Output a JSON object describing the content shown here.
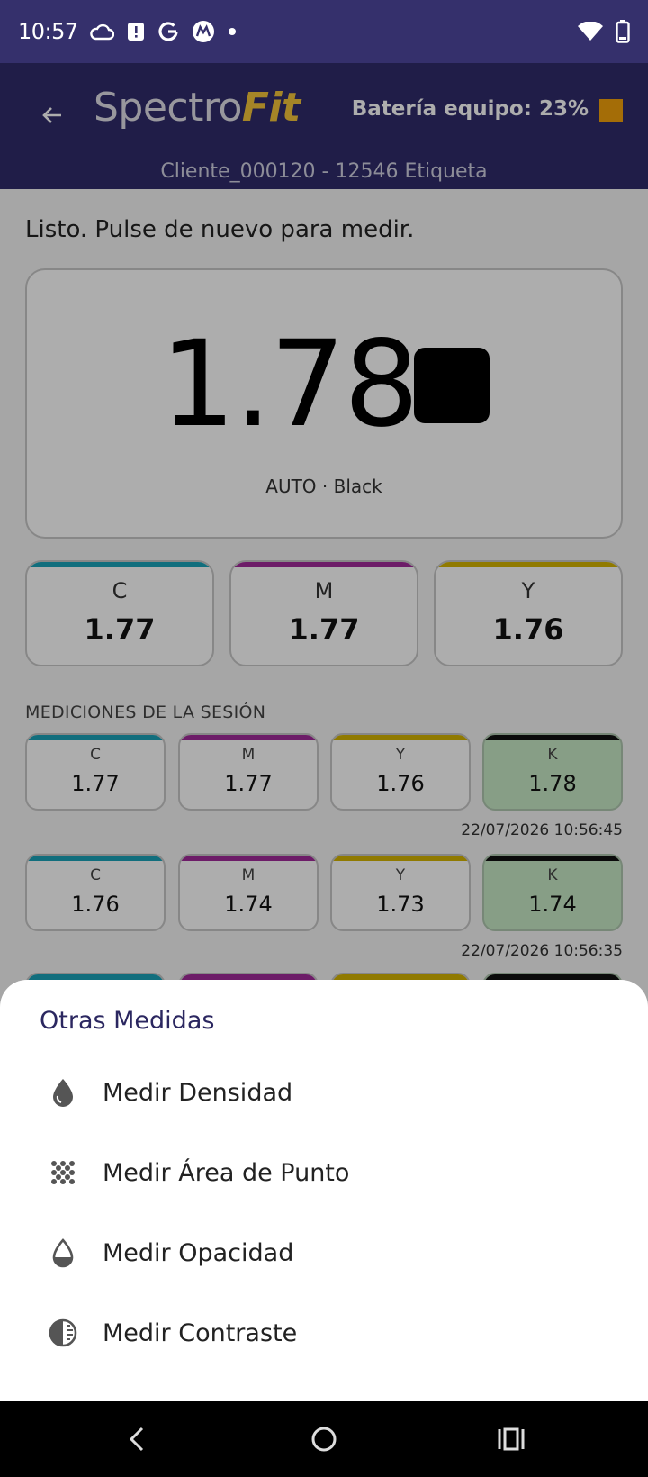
{
  "status_bar": {
    "time": "10:57",
    "icons_left": [
      "cloud-icon",
      "alert-icon",
      "google-icon",
      "motorola-icon",
      "dot-icon"
    ],
    "icons_right": [
      "wifi-icon",
      "battery-icon"
    ]
  },
  "app_bar": {
    "logo_thin": "Spectro",
    "logo_bold": "Fit",
    "battery_text": "Batería equipo: 23%",
    "battery_color": "#f2a10b",
    "subtitle": "Cliente_000120 - 12546 Etiqueta"
  },
  "main": {
    "status_message": "Listo. Pulse de nuevo para medir.",
    "value": "1.78",
    "swatch_color": "#000000",
    "caption": "AUTO · Black",
    "inks": [
      {
        "label": "C",
        "value": "1.77",
        "color": "#1aa3b8"
      },
      {
        "label": "M",
        "value": "1.77",
        "color": "#a12a9a"
      },
      {
        "label": "Y",
        "value": "1.76",
        "color": "#d4b400"
      }
    ]
  },
  "session": {
    "header": "MEDICIONES DE LA SESIÓN",
    "rows": [
      {
        "cells": [
          {
            "label": "C",
            "value": "1.77",
            "color": "#1aa3b8"
          },
          {
            "label": "M",
            "value": "1.77",
            "color": "#a12a9a"
          },
          {
            "label": "Y",
            "value": "1.76",
            "color": "#d4b400"
          },
          {
            "label": "K",
            "value": "1.78",
            "color": "#111111"
          }
        ],
        "timestamp": "22/07/2026 10:56:45"
      },
      {
        "cells": [
          {
            "label": "C",
            "value": "1.76",
            "color": "#1aa3b8"
          },
          {
            "label": "M",
            "value": "1.74",
            "color": "#a12a9a"
          },
          {
            "label": "Y",
            "value": "1.73",
            "color": "#d4b400"
          },
          {
            "label": "K",
            "value": "1.74",
            "color": "#111111"
          }
        ],
        "timestamp": "22/07/2026 10:56:35"
      }
    ]
  },
  "sheet": {
    "title": "Otras Medidas",
    "items": [
      {
        "label": "Medir Densidad",
        "icon": "drop-icon"
      },
      {
        "label": "Medir Área de Punto",
        "icon": "dots-icon"
      },
      {
        "label": "Medir Opacidad",
        "icon": "half-drop-icon"
      },
      {
        "label": "Medir Contraste",
        "icon": "contrast-icon"
      }
    ]
  },
  "nav_bar": {
    "buttons": [
      "back-nav-icon",
      "home-nav-icon",
      "recents-nav-icon"
    ]
  }
}
